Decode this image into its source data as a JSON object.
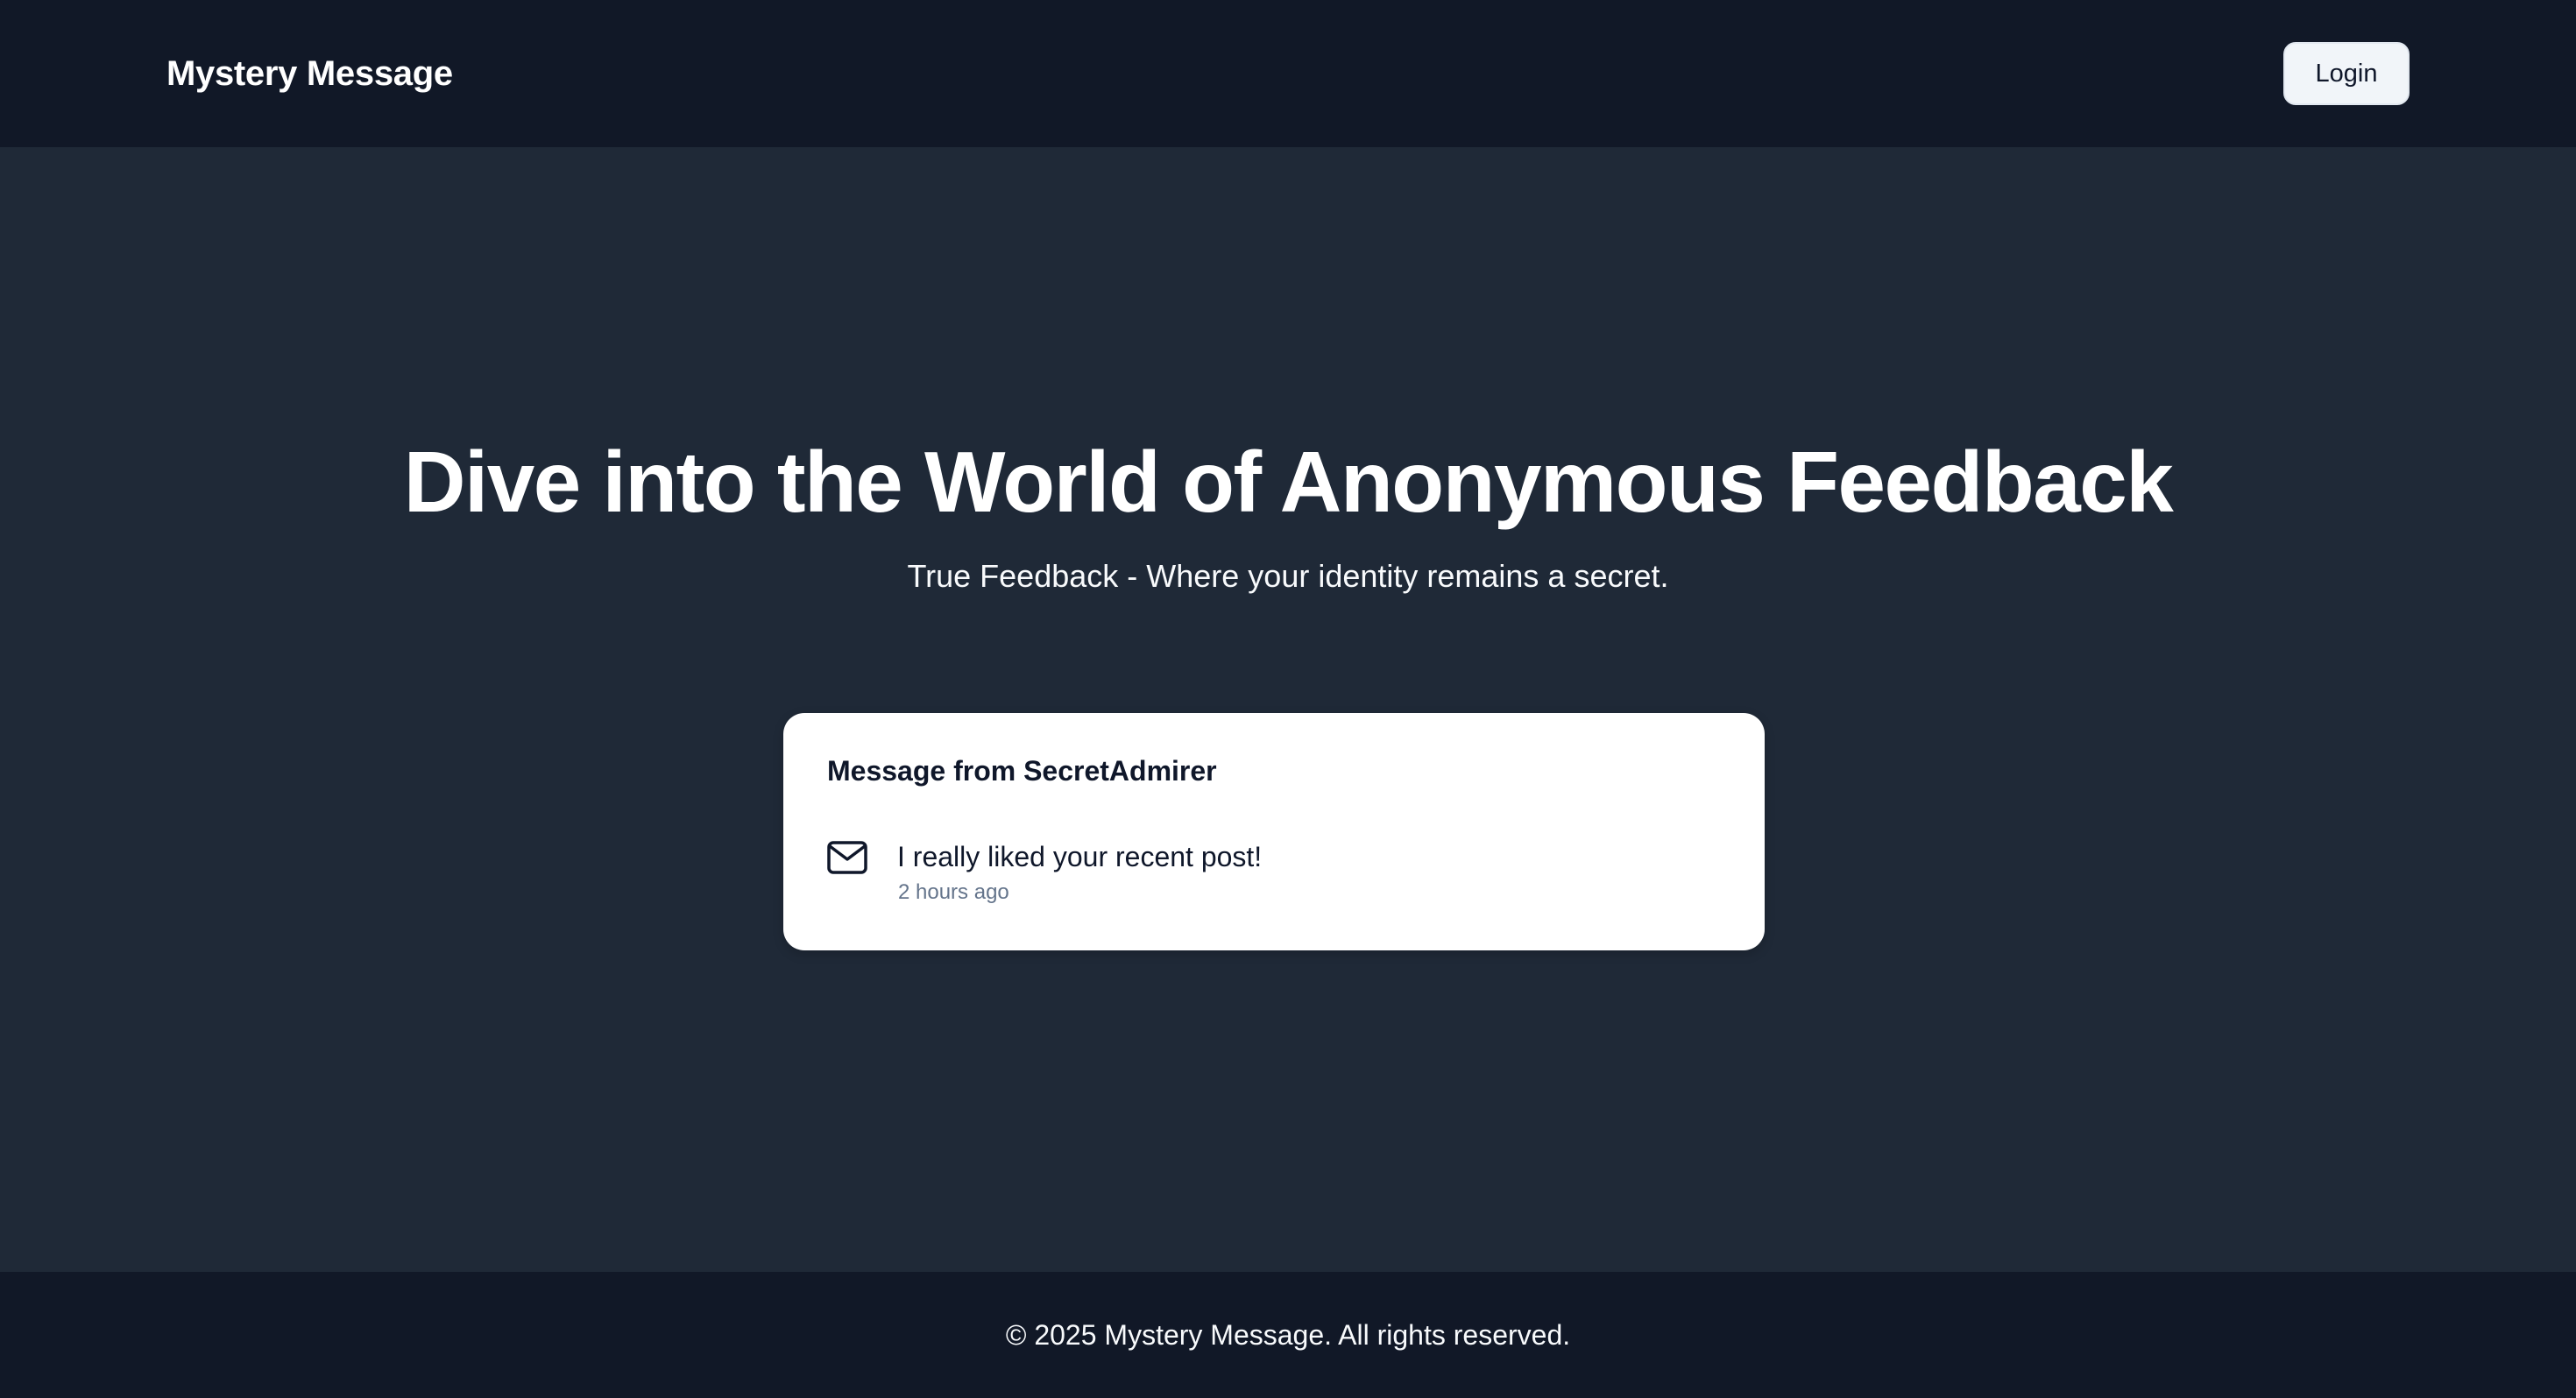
{
  "header": {
    "brand": "Mystery Message",
    "login_label": "Login"
  },
  "hero": {
    "title": "Dive into the World of Anonymous Feedback",
    "subtitle": "True Feedback - Where your identity remains a secret."
  },
  "message_card": {
    "title": "Message from SecretAdmirer",
    "icon": "mail-icon",
    "content": "I really liked your recent post!",
    "received": "2 hours ago"
  },
  "footer": {
    "copyright": "© 2025 Mystery Message. All rights reserved."
  },
  "colors": {
    "nav_background": "#111827",
    "page_background": "#1f2937",
    "card_background": "#ffffff",
    "button_background": "#f1f5f9",
    "muted_text": "#64748b"
  }
}
